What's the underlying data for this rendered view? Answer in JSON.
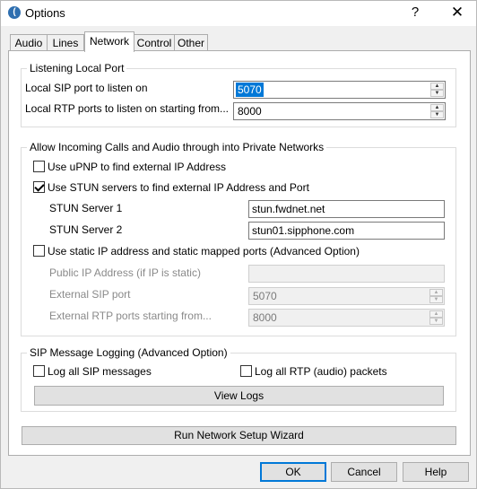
{
  "window": {
    "title": "Options",
    "help_label": "?",
    "close_label": "✕",
    "app_icon_glyph": "(",
    "app_icon": "phone-app-icon"
  },
  "tabs": [
    {
      "label": "Audio",
      "active": false
    },
    {
      "label": "Lines",
      "active": false
    },
    {
      "label": "Network",
      "active": true
    },
    {
      "label": "Control",
      "active": false
    },
    {
      "label": "Other",
      "active": false
    }
  ],
  "listening": {
    "title": "Listening Local Port",
    "sip_label": "Local SIP port to listen on",
    "sip_value": "5070",
    "rtp_label": "Local RTP ports to listen on starting from...",
    "rtp_value": "8000"
  },
  "nat": {
    "title": "Allow Incoming Calls and Audio through into Private Networks",
    "upnp_label": "Use uPNP to find external IP Address",
    "upnp_checked": false,
    "stun_label": "Use STUN servers to find external IP Address and Port",
    "stun_checked": true,
    "stun1_label": "STUN Server 1",
    "stun1_value": "stun.fwdnet.net",
    "stun2_label": "STUN Server 2",
    "stun2_value": "stun01.sipphone.com",
    "static_label": "Use static IP address and static mapped ports (Advanced Option)",
    "static_checked": false,
    "public_ip_label": "Public IP Address (if IP is static)",
    "public_ip_value": "",
    "ext_sip_label": "External SIP port",
    "ext_sip_value": "5070",
    "ext_rtp_label": "External RTP ports starting from...",
    "ext_rtp_value": "8000"
  },
  "logging": {
    "title": "SIP Message Logging (Advanced Option)",
    "log_sip_label": "Log all SIP messages",
    "log_sip_checked": false,
    "log_rtp_label": "Log all RTP (audio) packets",
    "log_rtp_checked": false,
    "view_logs_label": "View Logs"
  },
  "wizard_label": "Run Network Setup Wizard",
  "footer": {
    "ok_label": "OK",
    "cancel_label": "Cancel",
    "help_label": "Help"
  }
}
